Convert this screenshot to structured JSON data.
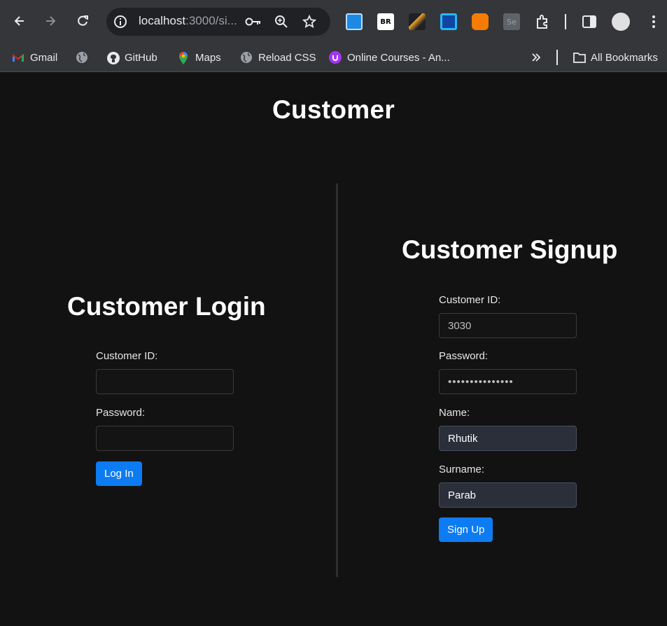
{
  "browser": {
    "url_host": "localhost",
    "url_rest": ":3000/si...",
    "bookmarks": [
      "Gmail",
      "",
      "GitHub",
      "Maps",
      "Reload CSS",
      "Online Courses - An..."
    ],
    "all_bookmarks": "All Bookmarks"
  },
  "page": {
    "title": "Customer",
    "login": {
      "title": "Customer Login",
      "customer_id_label": "Customer ID:",
      "customer_id_value": "",
      "password_label": "Password:",
      "password_value": "",
      "button": "Log In"
    },
    "signup": {
      "title": "Customer Signup",
      "customer_id_label": "Customer ID:",
      "customer_id_value": "3030",
      "password_label": "Password:",
      "password_value": "•••••••••••••••",
      "name_label": "Name:",
      "name_value": "Rhutik",
      "surname_label": "Surname:",
      "surname_value": "Parab",
      "button": "Sign Up"
    }
  },
  "colors": {
    "background": "#121212",
    "accent": "#0d7cf2",
    "filled_field": "#2a2f3a"
  }
}
